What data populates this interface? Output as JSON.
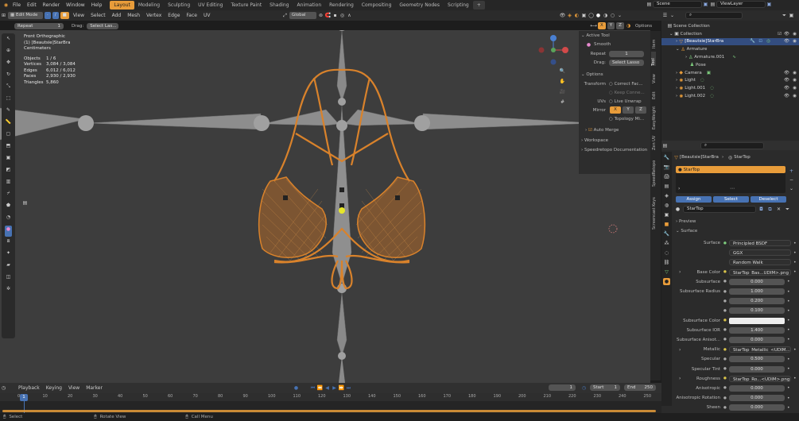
{
  "app": {
    "icon": "blender-logo-icon"
  },
  "menus": [
    "File",
    "Edit",
    "Render",
    "Window",
    "Help"
  ],
  "workspace_tabs": [
    {
      "label": "Layout",
      "active": true
    },
    {
      "label": "Modeling"
    },
    {
      "label": "Sculpting"
    },
    {
      "label": "UV Editing"
    },
    {
      "label": "Texture Paint"
    },
    {
      "label": "Shading"
    },
    {
      "label": "Animation"
    },
    {
      "label": "Rendering"
    },
    {
      "label": "Compositing"
    },
    {
      "label": "Geometry Nodes"
    },
    {
      "label": "Scripting"
    }
  ],
  "scene": {
    "name": "Scene",
    "view_layer": "ViewLayer"
  },
  "viewport_header": {
    "mode": "Edit Mode",
    "menus": [
      "View",
      "Select",
      "Add",
      "Mesh",
      "Vertex",
      "Edge",
      "Face",
      "UV"
    ],
    "transform": "Global",
    "options": "Options"
  },
  "tool_settings_bar": {
    "repeat_label": "Repeat",
    "repeat_value": "1",
    "drag_label": "Drag:",
    "drag_value": "Select Las..."
  },
  "overlay_text": {
    "view": "Front Orthographic",
    "object": "(1) [Beautsie]StarBra",
    "units": "Centimeters",
    "stats": [
      {
        "label": "Objects",
        "value": "1 / 6"
      },
      {
        "label": "Vertices",
        "value": "3,084 / 3,084"
      },
      {
        "label": "Edges",
        "value": "6,012 / 6,012"
      },
      {
        "label": "Faces",
        "value": "2,930 / 2,930"
      },
      {
        "label": "Triangles",
        "value": "5,860"
      }
    ]
  },
  "n_panel": {
    "tabs": [
      "Item",
      "Tool",
      "View",
      "Edit",
      "EasyWeight",
      "Zen UV",
      "SpeedRetopo",
      "Screencast Keys"
    ],
    "active_tool_header": "Active Tool",
    "tool_name": "Smooth",
    "repeat_label": "Repeat",
    "repeat_value": "1",
    "drag_label": "Drag:",
    "drag_value": "Select Lasso",
    "options_header": "Options",
    "transform_label": "Transform",
    "correct_face": "Correct Fac...",
    "keep_connected": "Keep Conne...",
    "uvs_label": "UVs",
    "live_unwrap": "Live Unwrap",
    "mirror_label": "Mirror",
    "mirror_axes": [
      "X",
      "Y",
      "Z"
    ],
    "topology_mirror": "Topology Mi...",
    "auto_merge": "Auto Merge",
    "workspace": "Workspace",
    "speedretopo_doc": "Speedretopo Documentation"
  },
  "outliner": {
    "items": [
      {
        "label": "Scene Collection",
        "icon": "scene-collection-icon",
        "depth": 0
      },
      {
        "label": "Collection",
        "icon": "collection-icon",
        "depth": 1
      },
      {
        "label": "[Beautsie]StarBra",
        "icon": "mesh-icon",
        "depth": 2,
        "selected": true
      },
      {
        "label": "Armature",
        "icon": "armature-icon",
        "depth": 2
      },
      {
        "label": "Armature.001",
        "icon": "armature-data-icon",
        "depth": 3
      },
      {
        "label": "Pose",
        "icon": "pose-icon",
        "depth": 3
      },
      {
        "label": "Camera",
        "icon": "camera-icon",
        "depth": 2
      },
      {
        "label": "Light",
        "icon": "light-icon",
        "depth": 2
      },
      {
        "label": "Light.001",
        "icon": "light-icon",
        "depth": 2
      },
      {
        "label": "Light.002",
        "icon": "light-icon",
        "depth": 2
      }
    ]
  },
  "properties": {
    "breadcrumb_object": "[Beautsie]StarBra",
    "breadcrumb_material": "StarTop",
    "slot_name": "StarTop",
    "assign": "Assign",
    "select": "Select",
    "deselect": "Deselect",
    "material_name": "StarTop",
    "preview": "Preview",
    "surface_section": "Surface",
    "rows": [
      {
        "label": "Surface",
        "value": "Principled BSDF",
        "kind": "shader"
      },
      {
        "label": "",
        "value": "GGX",
        "kind": "dropdown"
      },
      {
        "label": "",
        "value": "Random Walk",
        "kind": "dropdown"
      },
      {
        "label": "Base Color",
        "value": "StarTop_Bas...UDIM>.png",
        "kind": "texture"
      },
      {
        "label": "Subsurface",
        "value": "0.000",
        "kind": "num"
      },
      {
        "label": "Subsurface Radius",
        "value": "1.000",
        "kind": "num"
      },
      {
        "label": "",
        "value": "0.200",
        "kind": "num"
      },
      {
        "label": "",
        "value": "0.100",
        "kind": "num"
      },
      {
        "label": "Subsurface Color",
        "value": "",
        "kind": "color"
      },
      {
        "label": "Subsurface IOR",
        "value": "1.400",
        "kind": "num"
      },
      {
        "label": "Subsurface Anisot...",
        "value": "0.000",
        "kind": "num"
      },
      {
        "label": "Metallic",
        "value": "StarTop_Metallic_<UDIM...",
        "kind": "texture"
      },
      {
        "label": "Specular",
        "value": "0.500",
        "kind": "num"
      },
      {
        "label": "Specular Tint",
        "value": "0.000",
        "kind": "num"
      },
      {
        "label": "Roughness",
        "value": "StarTop_Ro...<UDIM>.png",
        "kind": "texture"
      },
      {
        "label": "Anisotropic",
        "value": "0.000",
        "kind": "num"
      },
      {
        "label": "Anisotropic Rotation",
        "value": "0.000",
        "kind": "num"
      },
      {
        "label": "Sheen",
        "value": "0.000",
        "kind": "num"
      }
    ]
  },
  "timeline": {
    "menus": [
      "Playback",
      "Keying",
      "View",
      "Marker"
    ],
    "current_frame": "1",
    "start_label": "Start",
    "start_value": "1",
    "end_label": "End",
    "end_value": "250",
    "ticks": [
      "0",
      "10",
      "20",
      "30",
      "40",
      "50",
      "60",
      "70",
      "80",
      "90",
      "100",
      "110",
      "120",
      "130",
      "140",
      "150",
      "160",
      "170",
      "180",
      "190",
      "200",
      "210",
      "220",
      "230",
      "240",
      "250"
    ],
    "frame_marker": "1"
  },
  "status_bar": {
    "left": "Select",
    "middle": "Rotate View",
    "right": "Call Menu"
  },
  "colors": {
    "accent": "#e89c3a",
    "selection": "#4772b3",
    "mesh_wire": "#d9822b",
    "viewport_bg": "#3d3d3d"
  }
}
